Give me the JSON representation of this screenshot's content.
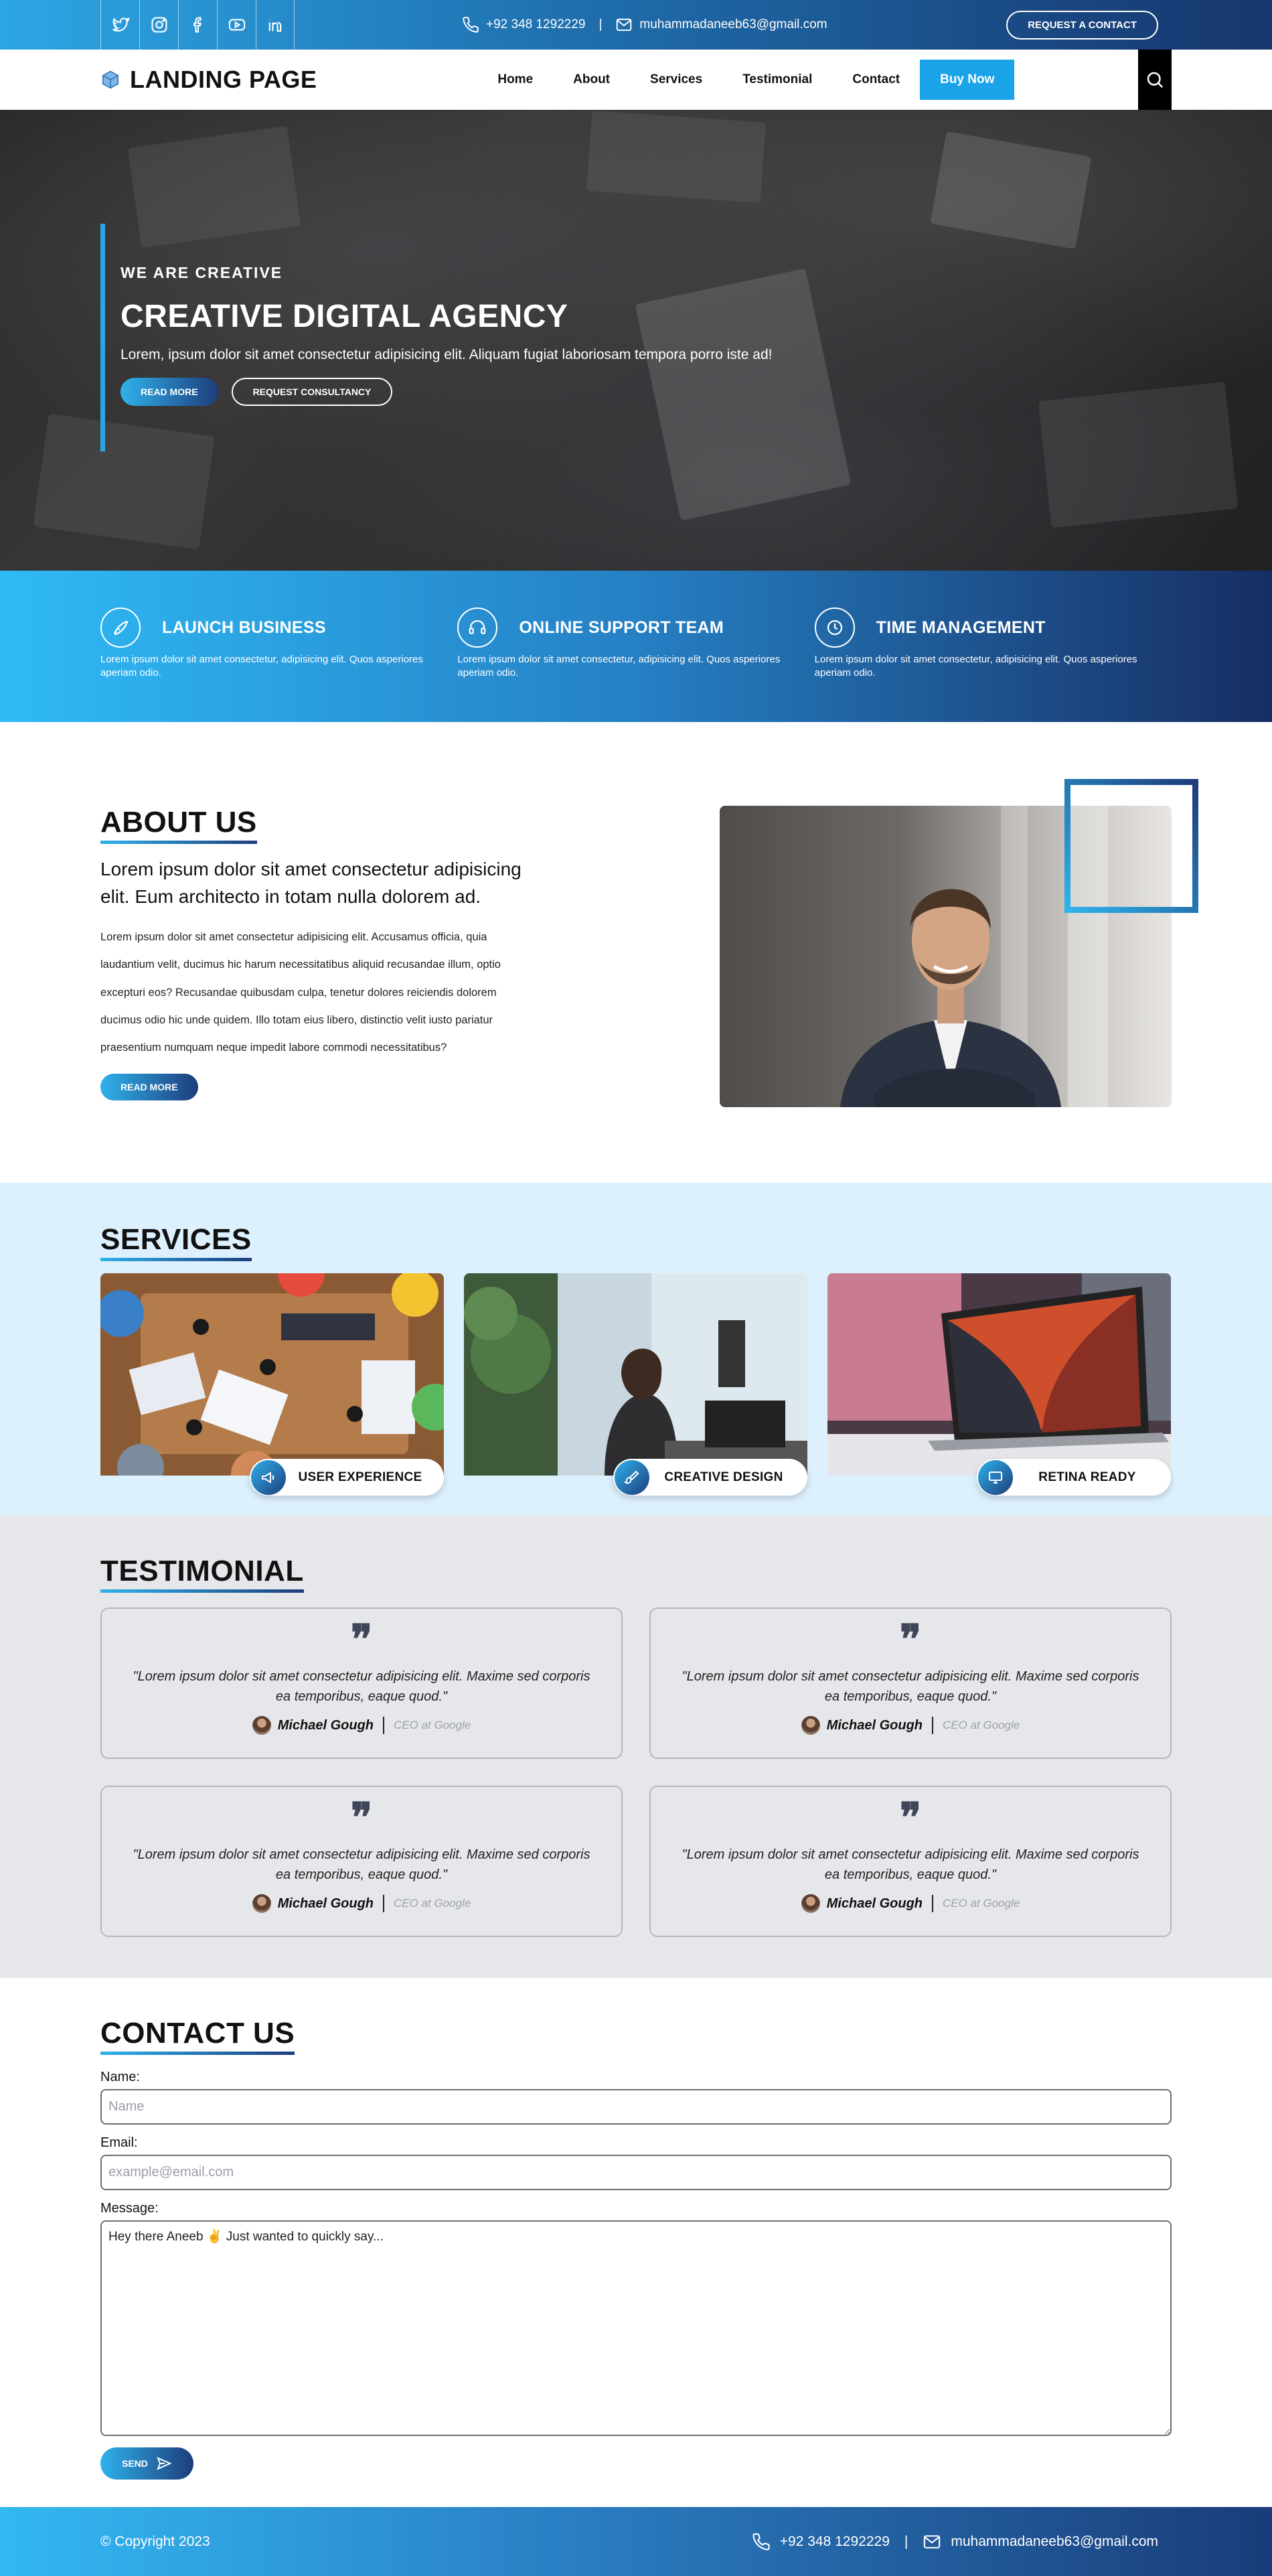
{
  "topbar": {
    "socials": [
      "twitter-icon",
      "instagram-icon",
      "facebook-icon",
      "youtube-icon",
      "linkedin-icon"
    ],
    "phone": "+92 348 1292229",
    "email": "muhammadaneeb63@gmail.com",
    "separator": "|",
    "request_label": "REQUEST A CONTACT"
  },
  "nav": {
    "logo": "LANDING PAGE",
    "items": [
      "Home",
      "About",
      "Services",
      "Testimonial",
      "Contact"
    ],
    "buy_label": "Buy Now"
  },
  "hero": {
    "eyebrow": "WE ARE CREATIVE",
    "title": "CREATIVE DIGITAL AGENCY",
    "text": "Lorem, ipsum dolor sit amet consectetur adipisicing elit. Aliquam fugiat laboriosam tempora porro iste ad!",
    "read_more": "READ MORE",
    "consult": "REQUEST CONSULTANCY"
  },
  "features": [
    {
      "icon": "rocket-icon",
      "title": "LAUNCH BUSINESS",
      "text": "Lorem ipsum dolor sit amet consectetur, adipisicing elit. Quos asperiores aperiam odio."
    },
    {
      "icon": "headset-icon",
      "title": "ONLINE SUPPORT TEAM",
      "text": "Lorem ipsum dolor sit amet consectetur, adipisicing elit. Quos asperiores aperiam odio."
    },
    {
      "icon": "clock-icon",
      "title": "TIME MANAGEMENT",
      "text": "Lorem ipsum dolor sit amet consectetur, adipisicing elit. Quos asperiores aperiam odio."
    }
  ],
  "about": {
    "title": "ABOUT US",
    "lead": "Lorem ipsum dolor sit amet consectetur adipisicing elit. Eum architecto in totam nulla dolorem ad.",
    "body": "Lorem ipsum dolor sit amet consectetur adipisicing elit. Accusamus officia, quia laudantium velit, ducimus hic harum necessitatibus aliquid recusandae illum, optio excepturi eos? Recusandae quibusdam culpa, tenetur dolores reiciendis dolorem ducimus odio hic unde quidem. Illo totam eius libero, distinctio velit iusto pariatur praesentium numquam neque impedit labore commodi necessitatibus?",
    "button": "READ MORE"
  },
  "services": {
    "title": "SERVICES",
    "cards": [
      {
        "icon": "megaphone-icon",
        "label": "USER EXPERIENCE"
      },
      {
        "icon": "brush-icon",
        "label": "CREATIVE DESIGN"
      },
      {
        "icon": "monitor-icon",
        "label": "RETINA READY"
      }
    ]
  },
  "testimonials": {
    "title": "TESTIMONIAL",
    "items": [
      {
        "quote": "\"Lorem ipsum dolor sit amet consectetur adipisicing elit. Maxime sed corporis ea temporibus, eaque quod.\"",
        "name": "Michael Gough",
        "role": "CEO at Google"
      },
      {
        "quote": "\"Lorem ipsum dolor sit amet consectetur adipisicing elit. Maxime sed corporis ea temporibus, eaque quod.\"",
        "name": "Michael Gough",
        "role": "CEO at Google"
      },
      {
        "quote": "\"Lorem ipsum dolor sit amet consectetur adipisicing elit. Maxime sed corporis ea temporibus, eaque quod.\"",
        "name": "Michael Gough",
        "role": "CEO at Google"
      },
      {
        "quote": "\"Lorem ipsum dolor sit amet consectetur adipisicing elit. Maxime sed corporis ea temporibus, eaque quod.\"",
        "name": "Michael Gough",
        "role": "CEO at Google"
      }
    ]
  },
  "contact": {
    "title": "CONTACT US",
    "name_label": "Name:",
    "name_placeholder": "Name",
    "email_label": "Email:",
    "email_placeholder": "example@email.com",
    "message_label": "Message:",
    "message_value": "Hey there Aneeb ✌ Just wanted to quickly say...",
    "send": "SEND"
  },
  "footer": {
    "copyright": "© Copyright 2023",
    "phone": "+92 348 1292229",
    "email": "muhammadaneeb63@gmail.com",
    "separator": "|"
  }
}
